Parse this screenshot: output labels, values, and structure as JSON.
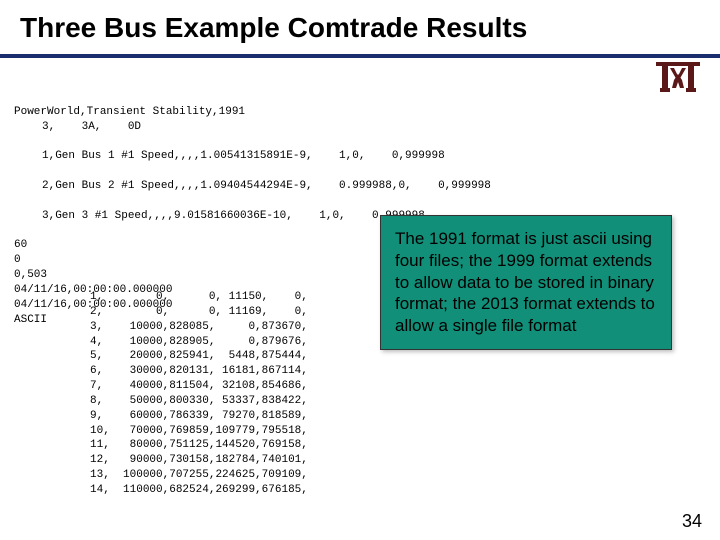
{
  "title": "Three Bus Example Comtrade Results",
  "logo_alt": "Texas A&M",
  "cfg": {
    "line1": "PowerWorld,Transient Stability,1991",
    "line2": "3,    3A,    0D",
    "ch1": "1,Gen Bus 1 #1 Speed,,,,1.00541315891E-9,    1,0,    0,999998",
    "ch2": "2,Gen Bus 2 #1 Speed,,,,1.09404544294E-9,    0.999988,0,    0,999998",
    "ch3": "3,Gen 3 #1 Speed,,,,9.01581660036E-10,    1,0,    0,999998",
    "freq": "60",
    "nrates": "0",
    "endsamp": "0,503",
    "ts_start": "04/11/16,00:00:00.000000",
    "ts_end": "04/11/16,00:00:00.000000",
    "ft": "ASCII"
  },
  "dat": [
    {
      "n": "1,",
      "c1": "0,",
      "c2": "0,",
      "c3": "11150,",
      "c4": "0,"
    },
    {
      "n": "2,",
      "c1": "0,",
      "c2": "0,",
      "c3": "11169,",
      "c4": "0,"
    },
    {
      "n": "3,",
      "c1": "10000,",
      "c2": "828085,",
      "c3": "0,",
      "c4": "873670,"
    },
    {
      "n": "4,",
      "c1": "10000,",
      "c2": "828905,",
      "c3": "0,",
      "c4": "879676,"
    },
    {
      "n": "5,",
      "c1": "20000,",
      "c2": "825941,",
      "c3": "5448,",
      "c4": "875444,"
    },
    {
      "n": "6,",
      "c1": "30000,",
      "c2": "820131,",
      "c3": "16181,",
      "c4": "867114,"
    },
    {
      "n": "7,",
      "c1": "40000,",
      "c2": "811504,",
      "c3": "32108,",
      "c4": "854686,"
    },
    {
      "n": "8,",
      "c1": "50000,",
      "c2": "800330,",
      "c3": "53337,",
      "c4": "838422,"
    },
    {
      "n": "9,",
      "c1": "60000,",
      "c2": "786339,",
      "c3": "79270,",
      "c4": "818589,"
    },
    {
      "n": "10,",
      "c1": "70000,",
      "c2": "769859,",
      "c3": "109779,",
      "c4": "795518,"
    },
    {
      "n": "11,",
      "c1": "80000,",
      "c2": "751125,",
      "c3": "144520,",
      "c4": "769158,"
    },
    {
      "n": "12,",
      "c1": "90000,",
      "c2": "730158,",
      "c3": "182784,",
      "c4": "740101,"
    },
    {
      "n": "13,",
      "c1": "100000,",
      "c2": "707255,",
      "c3": "224625,",
      "c4": "709109,"
    },
    {
      "n": "14,",
      "c1": "110000,",
      "c2": "682524,",
      "c3": "269299,",
      "c4": "676185,"
    }
  ],
  "callout": "The 1991 format is just ascii using four files; the 1999 format extends to allow data to be stored in binary format; the 2013 format extends to allow a single file format",
  "page_number": "34"
}
